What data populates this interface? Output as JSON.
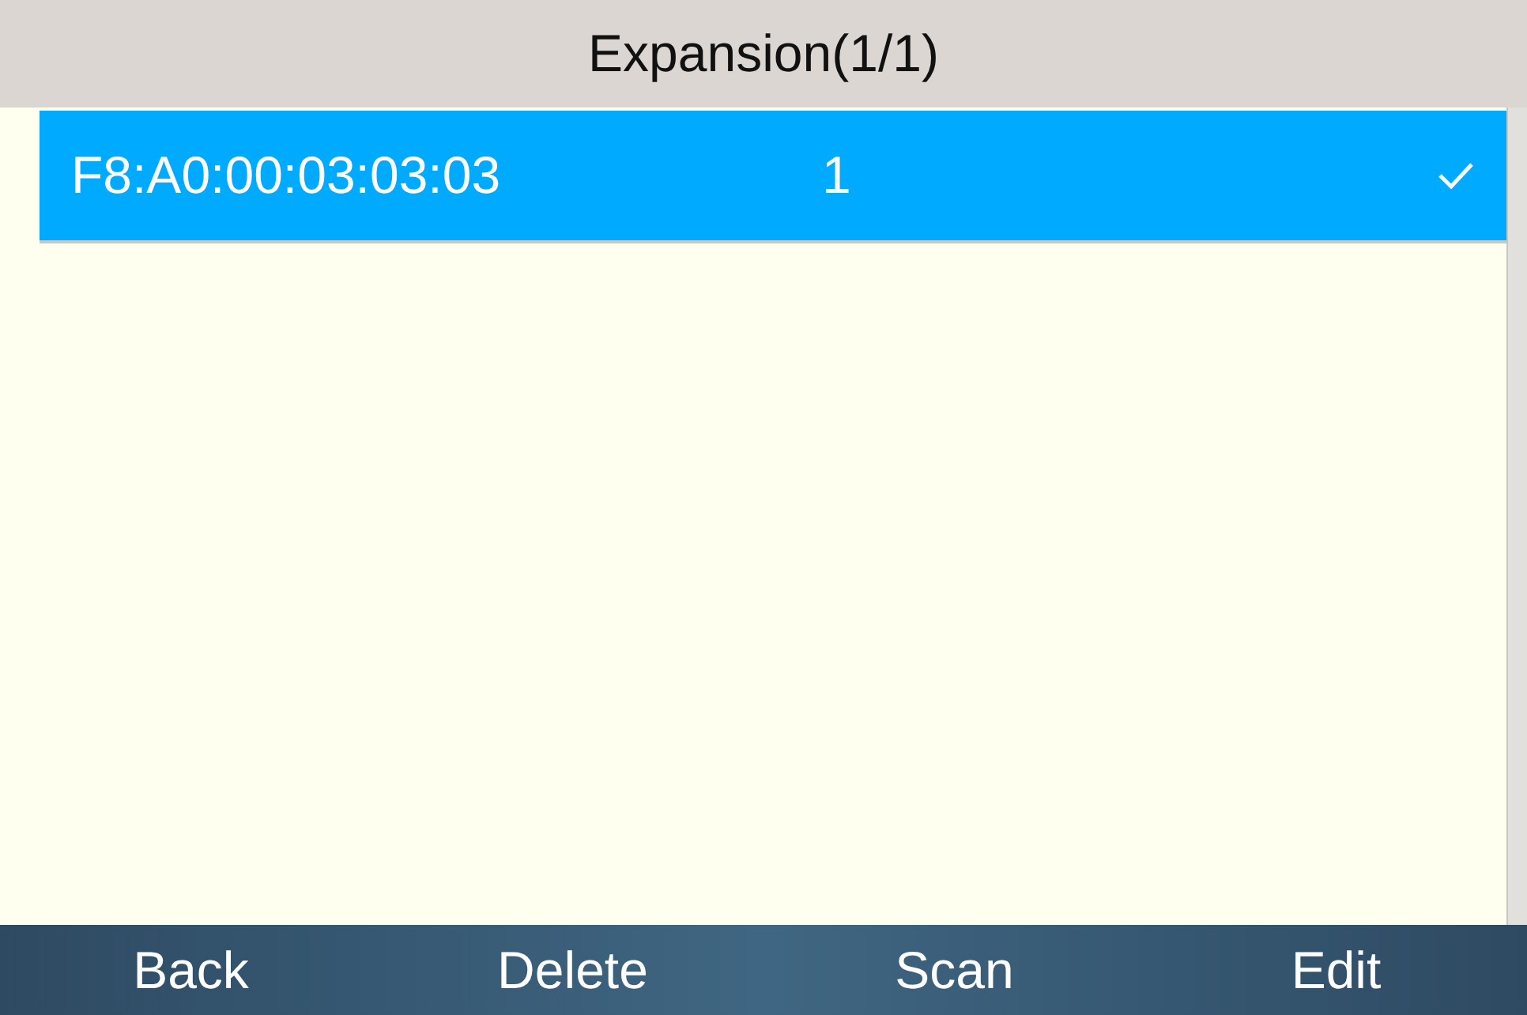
{
  "title": "Expansion(1/1)",
  "rows": [
    {
      "address": "F8:A0:00:03:03:03",
      "number": "1",
      "selected": true,
      "checked": true
    }
  ],
  "softkeys": [
    "Back",
    "Delete",
    "Scan",
    "Edit"
  ]
}
